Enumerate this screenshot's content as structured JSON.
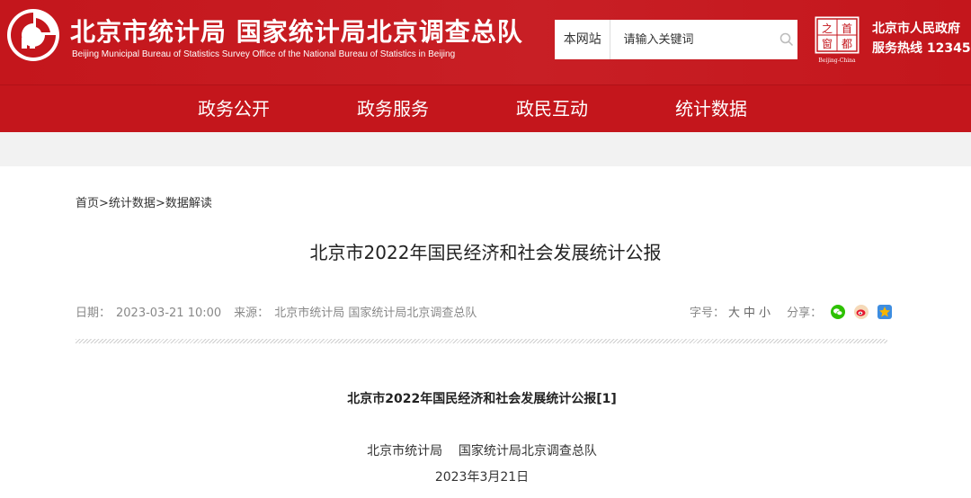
{
  "header": {
    "title": "北京市统计局 国家统计局北京调查总队",
    "subtitle": "Beijing Municipal Bureau of Statistics  Survey Office of the National Bureau of Statistics in Beijing",
    "search": {
      "scope_label": "本网站",
      "placeholder": "请输入关键词"
    },
    "capital_logo": {
      "chars": [
        "之",
        "首",
        "窗",
        "都"
      ],
      "caption": "Beijing-China"
    },
    "gov_name": "北京市人民政府",
    "hotline": "服务热线 12345"
  },
  "nav": {
    "items": [
      {
        "label": "政务公开"
      },
      {
        "label": "政务服务"
      },
      {
        "label": "政民互动"
      },
      {
        "label": "统计数据"
      }
    ]
  },
  "breadcrumb": {
    "items": [
      "首页",
      "统计数据",
      "数据解读"
    ],
    "separator": ">"
  },
  "article": {
    "title": "北京市2022年国民经济和社会发展统计公报",
    "meta": {
      "date_label": "日期：",
      "date": "2023-03-21 10:00",
      "source_label": "来源：",
      "source": "北京市统计局 国家统计局北京调查总队"
    },
    "font_size_label": "字号：",
    "font_sizes": [
      "大",
      "中",
      "小"
    ],
    "share_label": "分享：",
    "share_icons": [
      "wechat-icon",
      "weibo-icon",
      "qzone-icon"
    ],
    "body": {
      "heading": "北京市2022年国民经济和社会发展统计公报[1]",
      "author": "北京市统计局    国家统计局北京调查总队",
      "date": "2023年3月21日"
    }
  },
  "colors": {
    "brand_red": "#c4161c",
    "wechat_green": "#2dc100",
    "weibo_red": "#e6162d",
    "qzone_yellow": "#f7b500"
  }
}
